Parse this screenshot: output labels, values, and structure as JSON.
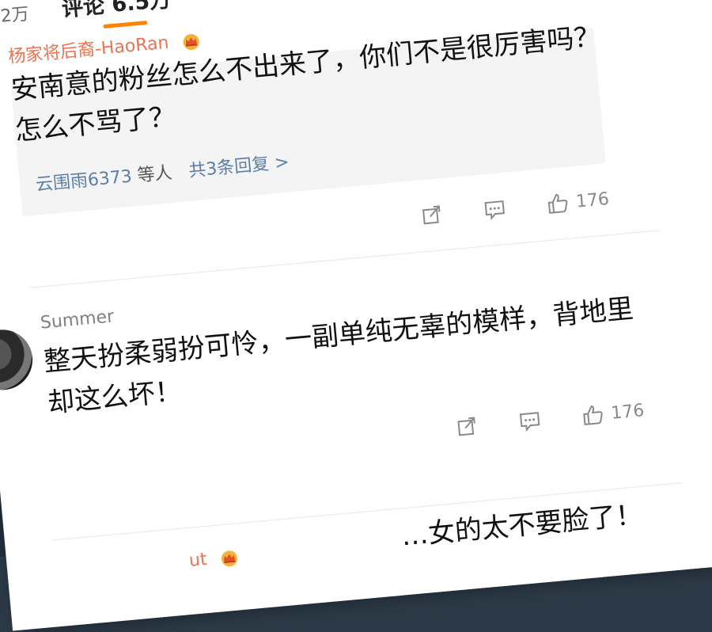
{
  "tabs": {
    "prev_label": "2万",
    "active_label": "评论 6.5万"
  },
  "colors": {
    "accent": "#ff8200",
    "username": "#eb7350",
    "link": "#5b7ea6"
  },
  "comments": [
    {
      "username": "杨家将后裔-HaoRan",
      "badge_icon": "crown-icon",
      "text": "安南意的粉丝怎么不出来了，你们不是很厉害吗？怎么不骂了？",
      "reply_nick": "云围雨6373",
      "reply_others": "等人",
      "reply_count": "共3条回复 >",
      "likes": "176"
    },
    {
      "username": "Summer",
      "text": "整天扮柔弱扮可怜，一副单纯无辜的模样，背地里却这么坏！",
      "likes": "176"
    },
    {
      "username": "ut",
      "badge_icon": "crown-icon",
      "text": "…女的太不要脸了！"
    }
  ]
}
